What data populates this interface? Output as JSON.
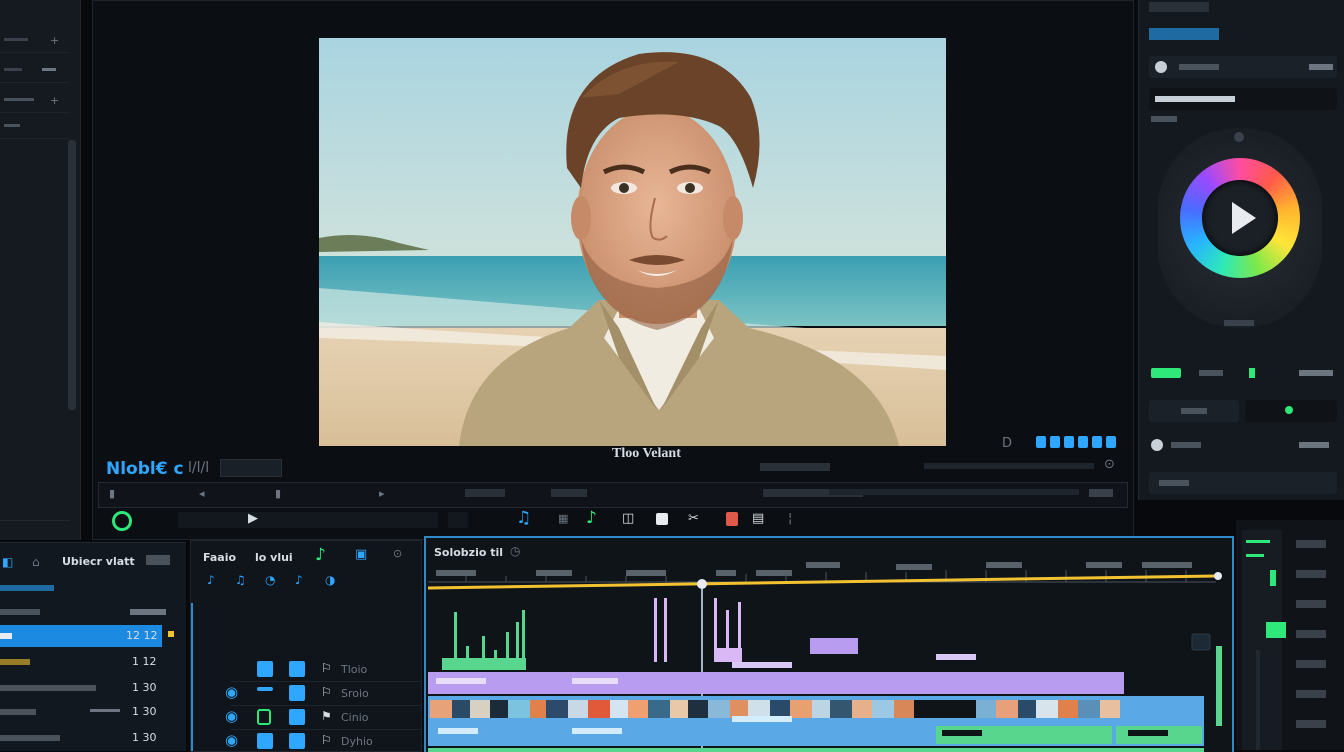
{
  "viewer": {
    "overlay_title": "Tloo Velant",
    "label_left": "Nlobl€ c",
    "label_right": "l/l/l"
  },
  "bin": {
    "title": "Ubiecr vlatt"
  },
  "effects": {
    "tab1": "Faaio",
    "tab2": "lo vlui",
    "items": [
      "Tloio",
      "Sroio",
      "Cinio",
      "Dyhio"
    ]
  },
  "timeline": {
    "title": "Solobzio til"
  },
  "bin_list": {
    "values": [
      "12 12",
      "1 12",
      "1 30",
      "1 30",
      "1 30"
    ]
  },
  "colors": {
    "accent_blue": "#2fa6ff",
    "accent_green": "#2ee87a",
    "clip_purple": "#b89cf0",
    "clip_blue": "#5aa9e6",
    "clip_green": "#58d68d",
    "playhead_yellow": "#f2c230"
  }
}
